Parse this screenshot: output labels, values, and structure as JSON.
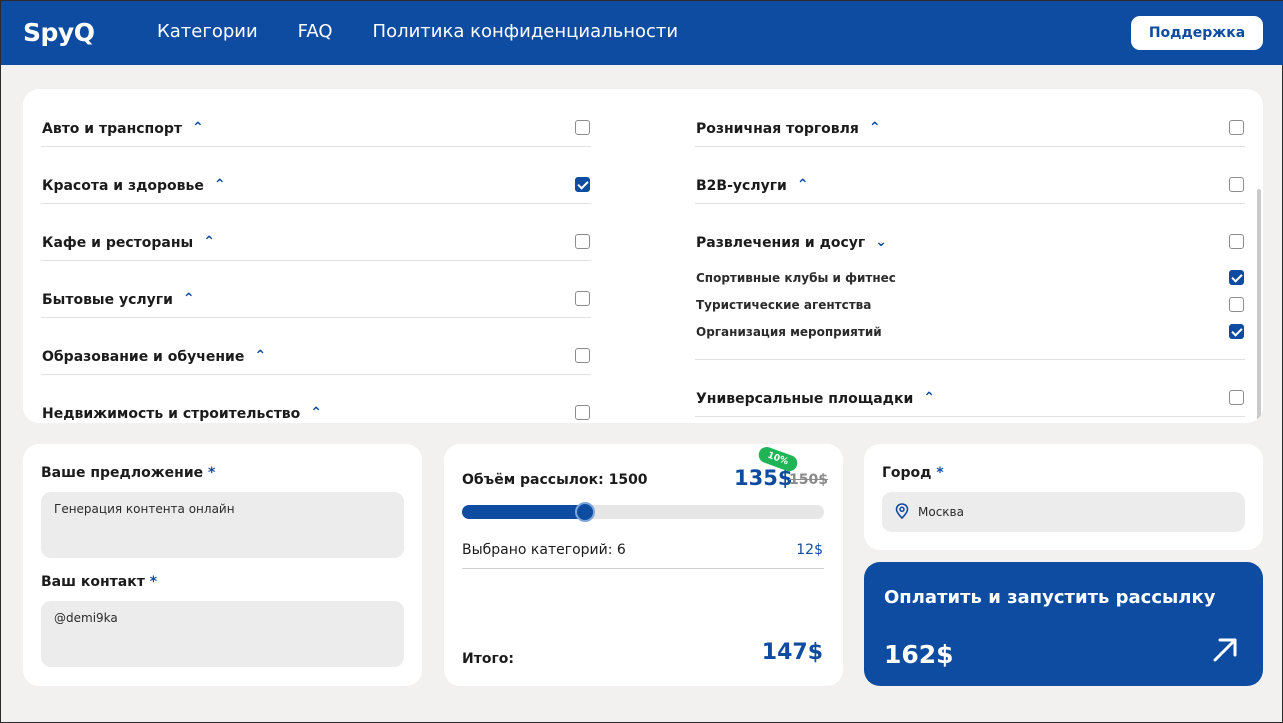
{
  "header": {
    "logo": "SpyQ",
    "nav": [
      "Категории",
      "FAQ",
      "Политика конфиденциальности"
    ],
    "support_label": "Поддержка"
  },
  "categories": {
    "left": [
      {
        "label": "Авто и транспорт",
        "checked": false,
        "expanded": false
      },
      {
        "label": "Красота и здоровье",
        "checked": true,
        "expanded": false
      },
      {
        "label": "Кафе и рестораны",
        "checked": false,
        "expanded": false
      },
      {
        "label": "Бытовые услуги",
        "checked": false,
        "expanded": false
      },
      {
        "label": "Образование и обучение",
        "checked": false,
        "expanded": false
      },
      {
        "label": "Недвижимость и строительство",
        "checked": false,
        "expanded": false
      }
    ],
    "right": [
      {
        "label": "Розничная торговля",
        "checked": false,
        "expanded": false
      },
      {
        "label": "B2B-услуги",
        "checked": false,
        "expanded": false
      },
      {
        "label": "Развлечения и досуг",
        "checked": false,
        "expanded": true,
        "subs": [
          {
            "label": "Спортивные клубы и фитнес",
            "checked": true
          },
          {
            "label": "Туристические агентства",
            "checked": false
          },
          {
            "label": "Организация мероприятий",
            "checked": true
          }
        ]
      },
      {
        "label": "Универсальные площадки",
        "checked": false,
        "expanded": false
      }
    ]
  },
  "offer": {
    "label": "Ваше предложение",
    "value": "Генерация контента онлайн",
    "required_mark": "*"
  },
  "contact": {
    "label": "Ваш контакт",
    "value": "@demi9ka",
    "required_mark": "*"
  },
  "volume": {
    "label": "Объём рассылок: 1500",
    "price_new": "135$",
    "price_old": "150$",
    "discount": "10%",
    "slider_fraction": 0.34,
    "selected_label": "Выбрано категорий: 6",
    "selected_price": "12$",
    "total_label": "Итого:",
    "total_price": "147$"
  },
  "city": {
    "label": "Город",
    "required_mark": "*",
    "value": "Москва"
  },
  "pay": {
    "title": "Оплатить и запустить рассылку",
    "price": "162$"
  },
  "colors": {
    "brand": "#0e4ca1",
    "discount": "#1fb556",
    "background": "#f2f1ef"
  },
  "icons": [
    "chevron-up-icon",
    "chevron-down-icon",
    "map-pin-icon",
    "arrow-up-right-icon",
    "check-icon"
  ]
}
